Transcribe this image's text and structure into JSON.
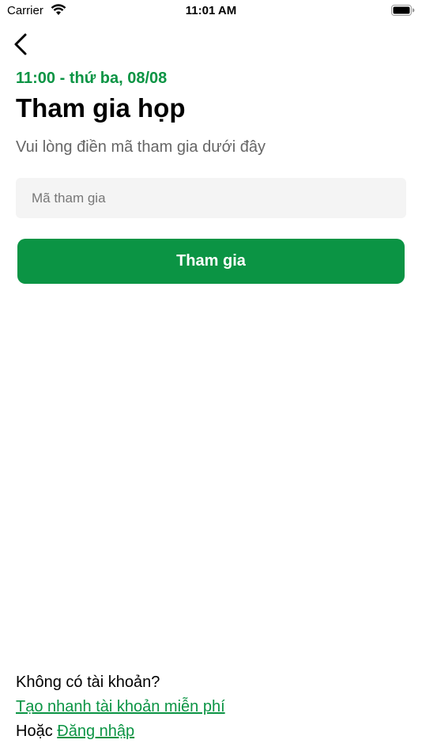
{
  "status_bar": {
    "carrier": "Carrier",
    "time": "11:01 AM"
  },
  "icons": {
    "wifi": "wifi-icon",
    "battery": "battery-icon",
    "back": "back-chevron-icon"
  },
  "header": {
    "datetime": "11:00 - thứ ba, 08/08",
    "title": "Tham gia họp",
    "subtitle": "Vui lòng điền mã tham gia dưới đây"
  },
  "form": {
    "code_placeholder": "Mã tham gia",
    "code_value": "",
    "join_label": "Tham gia"
  },
  "footer": {
    "no_account": "Không có tài khoản?",
    "create_link": "Tạo nhanh tài khoản miễn phí",
    "or_text": "Hoặc ",
    "login_link": "Đăng nhập"
  },
  "colors": {
    "accent": "#0b9444",
    "field_bg": "#f4f4f4",
    "subtitle": "#666666"
  }
}
